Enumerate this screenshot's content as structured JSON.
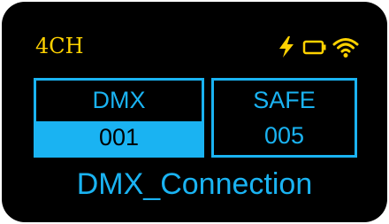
{
  "header": {
    "mode_label": "4CH",
    "icons": [
      "lightning-bolt-icon",
      "battery-icon",
      "wifi-icon"
    ]
  },
  "panels": [
    {
      "title": "DMX",
      "value": "001",
      "selected": true
    },
    {
      "title": "SAFE",
      "value": "005",
      "selected": false
    }
  ],
  "status_text": "DMX_Connection",
  "colors": {
    "background": "#000000",
    "accent": "#1ab3f2",
    "header": "#ffd200"
  }
}
